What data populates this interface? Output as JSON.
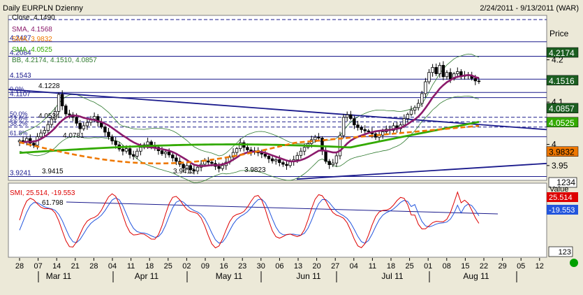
{
  "header": {
    "title": "Daily EURPLN Dzienny",
    "range": "2/24/2011 - 9/13/2011 (WAR)"
  },
  "colors": {
    "background": "#ffffff",
    "panel": "#ece9d8",
    "candle_up": "#ffffff",
    "candle_down": "#000000",
    "sma_short": "#8b1a6b",
    "sma_mid": "#33aa00",
    "sma_long": "#ee7700",
    "bollinger": "#2f7a2f",
    "trendline": "#1a1a8c",
    "fib_lines": "#1a1a8c",
    "smi": "#dd0000",
    "smi_signal": "#2255dd",
    "status_dot": "#00a000"
  },
  "chart_data": [
    {
      "type": "candlestick",
      "title": "Daily EURPLN Dzienny",
      "ylabel": "Price",
      "ylim": [
        3.915,
        4.305
      ],
      "price_ticks": [
        "4.2",
        "4.1",
        "4",
        "3.95"
      ],
      "fib_levels": [
        {
          "label": "38.2%",
          "value": 4.041
        },
        {
          "label": "50.0%",
          "value": 4.0641
        },
        {
          "label": "23.6%",
          "value": 4.0534
        },
        {
          "label": "0.0%",
          "value": 4.1228
        },
        {
          "label": "61.8%",
          "value": 4.0181
        },
        {
          "label": "4.2427",
          "value": 4.2427
        },
        {
          "label": "4.2084",
          "value": 4.2084
        },
        {
          "label": "4.1543",
          "value": 4.1543
        },
        {
          "label": "4.1107",
          "value": 4.1107
        },
        {
          "label": "3.9241",
          "value": 3.9241
        }
      ],
      "annotations": [
        {
          "label": "Close, 4.1490"
        },
        {
          "label": "4.1228"
        },
        {
          "label": "4.0534"
        },
        {
          "label": "4.0781"
        },
        {
          "label": "3.9415"
        },
        {
          "label": "3.9413"
        },
        {
          "label": "3.9823"
        }
      ],
      "series": [
        {
          "name": "SMA, 4.1568",
          "color": "#8b1a6b"
        },
        {
          "name": "SMA, 3.9832",
          "color": "#ee7700"
        },
        {
          "name": "SMA, 4.0525",
          "color": "#33aa00"
        },
        {
          "name": "BB, 4.2174, 4.1510, 4.0857",
          "color": "#2f7a2f"
        }
      ],
      "price_badges": [
        {
          "value": "4.2174",
          "bg": "#1b5e20",
          "fg": "#ffffff"
        },
        {
          "value": "4.1516",
          "bg": "#1b5e20",
          "fg": "#ffffff"
        },
        {
          "value": "4.0857",
          "bg": "#1b5e20",
          "fg": "#ffffff"
        },
        {
          "value": "4.0525",
          "bg": "#33aa00",
          "fg": "#ffffff"
        },
        {
          "value": "3.9832",
          "bg": "#ee7700",
          "fg": "#000000"
        }
      ],
      "price_box_value": "1234"
    },
    {
      "type": "line",
      "title": "SMI, 25.514, -19.553",
      "ylabel": "Value",
      "annotation": "61.798",
      "badges": [
        {
          "value": "25.514",
          "bg": "#dd0000",
          "fg": "#ffffff"
        },
        {
          "value": "-19.553",
          "bg": "#2255dd",
          "fg": "#ffffff"
        }
      ],
      "box_value": "123",
      "ylim": [
        -80,
        80
      ]
    }
  ],
  "xaxis": {
    "day_ticks": [
      "28",
      "07",
      "14",
      "21",
      "28",
      "04",
      "11",
      "18",
      "25",
      "02",
      "09",
      "16",
      "23",
      "30",
      "06",
      "13",
      "20",
      "27",
      "04",
      "11",
      "18",
      "25",
      "01",
      "08",
      "15",
      "22",
      "29",
      "05",
      "12"
    ],
    "months": [
      "Mar 11",
      "Apr 11",
      "May 11",
      "Jun 11",
      "Jul 11",
      "Aug 11"
    ]
  },
  "series_data": {
    "closes": [
      4.009,
      4.007,
      4.014,
      4.003,
      3.998,
      4.018,
      4.027,
      4.033,
      4.047,
      4.06,
      4.078,
      4.118,
      4.091,
      4.072,
      4.07,
      4.064,
      4.05,
      4.037,
      4.044,
      4.052,
      4.06,
      4.066,
      4.052,
      4.041,
      4.029,
      4.018,
      4.008,
      3.999,
      3.989,
      3.984,
      3.99,
      3.976,
      3.972,
      3.984,
      3.993,
      3.999,
      4.006,
      3.996,
      3.993,
      3.985,
      3.978,
      3.982,
      3.975,
      3.968,
      3.96,
      3.953,
      3.944,
      3.95,
      3.94,
      3.937,
      3.946,
      3.953,
      3.961,
      3.958,
      3.955,
      3.948,
      3.943,
      3.95,
      3.958,
      3.97,
      3.981,
      3.99,
      4.004,
      3.993,
      3.987,
      3.983,
      3.985,
      3.98,
      3.977,
      3.972,
      3.966,
      3.961,
      3.964,
      3.957,
      3.953,
      3.95,
      3.959,
      3.964,
      3.974,
      3.984,
      3.993,
      4.002,
      4.011,
      4.017,
      4.015,
      3.984,
      3.96,
      3.952,
      3.956,
      3.973,
      4.021,
      4.064,
      4.07,
      4.061,
      4.046,
      4.04,
      4.035,
      4.032,
      4.03,
      4.025,
      4.017,
      4.022,
      4.03,
      4.036,
      4.033,
      4.044,
      4.037,
      4.046,
      4.061,
      4.071,
      4.081,
      4.087,
      4.097,
      4.12,
      4.148,
      4.17,
      4.182,
      4.167,
      4.187,
      4.16,
      4.17,
      4.155,
      4.167,
      4.172,
      4.161,
      4.164,
      4.163,
      4.156,
      4.15,
      4.149
    ],
    "sma_short": [
      4.004,
      4.005,
      4.006,
      4.006,
      4.007,
      4.009,
      4.013,
      4.018,
      4.024,
      4.031,
      4.039,
      4.049,
      4.057,
      4.063,
      4.067,
      4.068,
      4.068,
      4.066,
      4.063,
      4.061,
      4.059,
      4.058,
      4.055,
      4.053,
      4.049,
      4.045,
      4.039,
      4.033,
      4.027,
      4.021,
      4.016,
      4.01,
      4.005,
      4.001,
      3.998,
      3.995,
      3.994,
      3.993,
      3.992,
      3.99,
      3.989,
      3.987,
      3.985,
      3.982,
      3.978,
      3.973,
      3.968,
      3.963,
      3.957,
      3.952,
      3.95,
      3.949,
      3.949,
      3.95,
      3.951,
      3.951,
      3.951,
      3.953,
      3.955,
      3.959,
      3.964,
      3.969,
      3.975,
      3.978,
      3.981,
      3.982,
      3.983,
      3.983,
      3.982,
      3.98,
      3.977,
      3.974,
      3.971,
      3.968,
      3.965,
      3.962,
      3.96,
      3.96,
      3.961,
      3.963,
      3.966,
      3.97,
      3.975,
      3.98,
      3.985,
      3.986,
      3.985,
      3.983,
      3.981,
      3.981,
      3.985,
      3.993,
      4.002,
      4.009,
      4.014,
      4.018,
      4.021,
      4.024,
      4.027,
      4.029,
      4.031,
      4.032,
      4.033,
      4.033,
      4.034,
      4.036,
      4.037,
      4.039,
      4.043,
      4.048,
      4.054,
      4.059,
      4.066,
      4.075,
      4.086,
      4.098,
      4.111,
      4.121,
      4.132,
      4.14,
      4.147,
      4.152,
      4.157,
      4.16,
      4.161,
      4.163,
      4.164,
      4.163,
      4.159,
      4.157
    ]
  }
}
